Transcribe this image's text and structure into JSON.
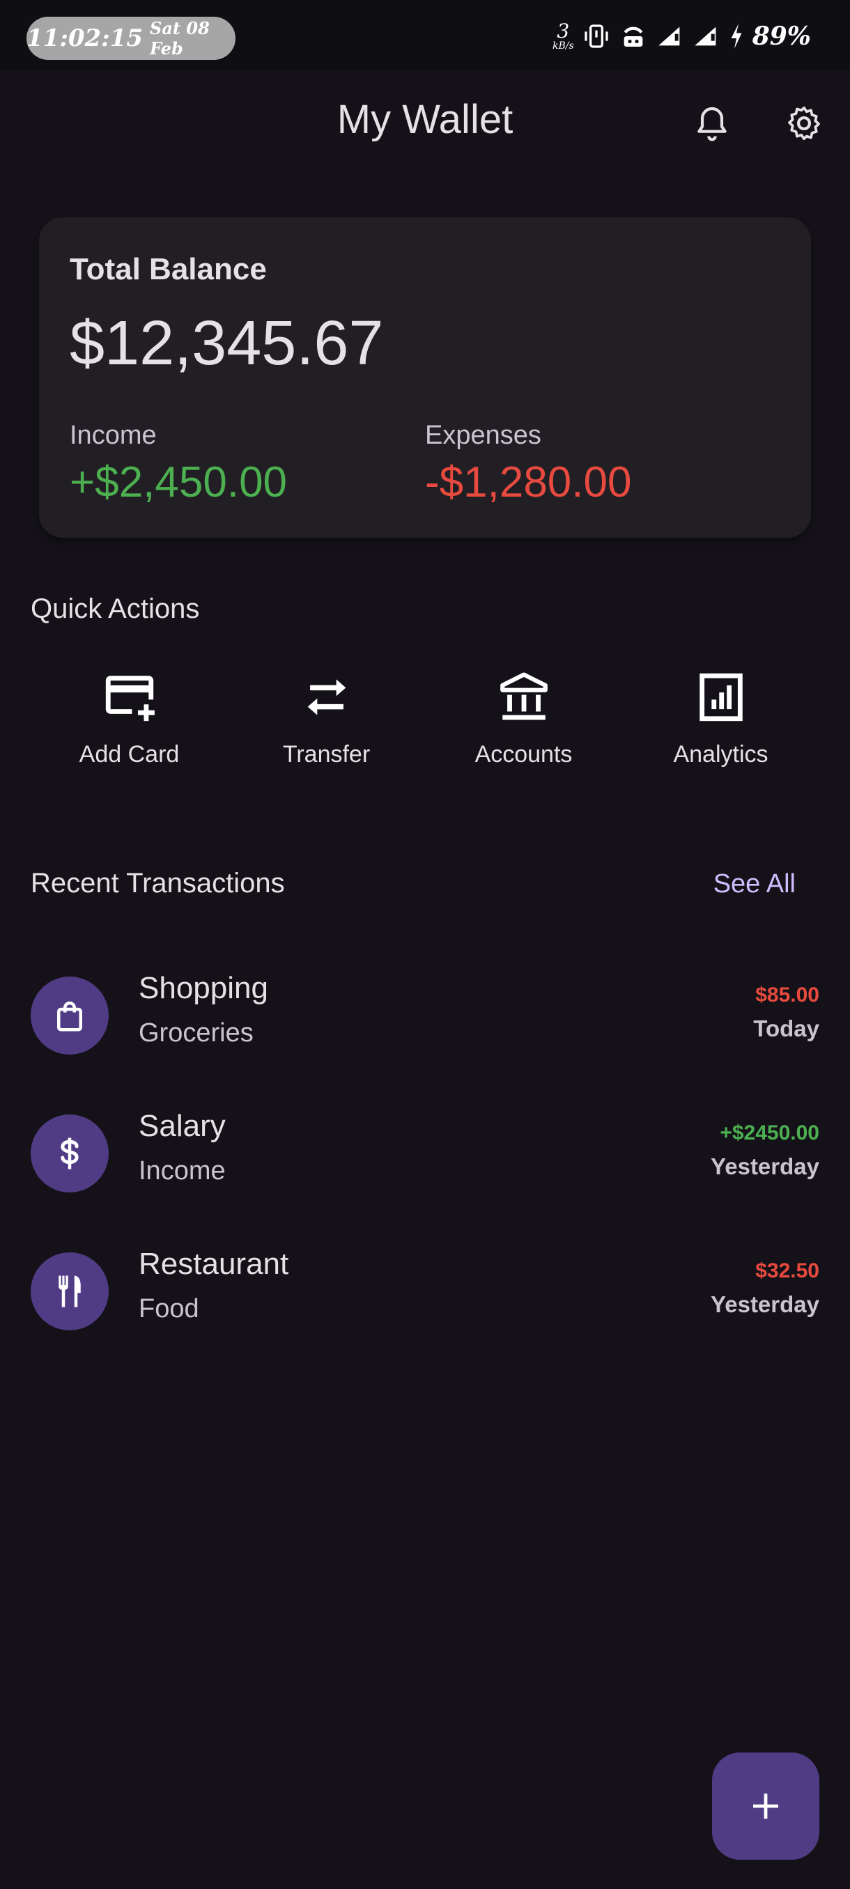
{
  "status_bar": {
    "time": "11:02:15",
    "date": "Sat 08 Feb",
    "net_speed_value": "3",
    "net_speed_unit": "kB/s",
    "battery": "89%"
  },
  "header": {
    "title": "My Wallet"
  },
  "balance_card": {
    "label": "Total Balance",
    "amount": "$12,345.67",
    "income_label": "Income",
    "income_value": "+$2,450.00",
    "expenses_label": "Expenses",
    "expenses_value": "-$1,280.00",
    "colors": {
      "income": "#4caf50",
      "expenses": "#e84a3f"
    }
  },
  "quick_actions": {
    "title": "Quick Actions",
    "items": [
      {
        "label": "Add Card",
        "icon": "add-card-icon"
      },
      {
        "label": "Transfer",
        "icon": "transfer-icon"
      },
      {
        "label": "Accounts",
        "icon": "bank-icon"
      },
      {
        "label": "Analytics",
        "icon": "analytics-icon"
      }
    ]
  },
  "transactions": {
    "title": "Recent Transactions",
    "see_all": "See All",
    "items": [
      {
        "title": "Shopping",
        "subtitle": "Groceries",
        "amount": "$85.00",
        "date": "Today",
        "icon": "shopping-bag-icon",
        "amount_color": "#e84a3f"
      },
      {
        "title": "Salary",
        "subtitle": "Income",
        "amount": "+$2450.00",
        "date": "Yesterday",
        "icon": "dollar-icon",
        "amount_color": "#4caf50"
      },
      {
        "title": "Restaurant",
        "subtitle": "Food",
        "amount": "$32.50",
        "date": "Yesterday",
        "icon": "restaurant-icon",
        "amount_color": "#e84a3f"
      }
    ]
  },
  "colors": {
    "accent": "#4f3c85",
    "link": "#d0bcff",
    "background": "#141218",
    "card": "#211f24"
  }
}
